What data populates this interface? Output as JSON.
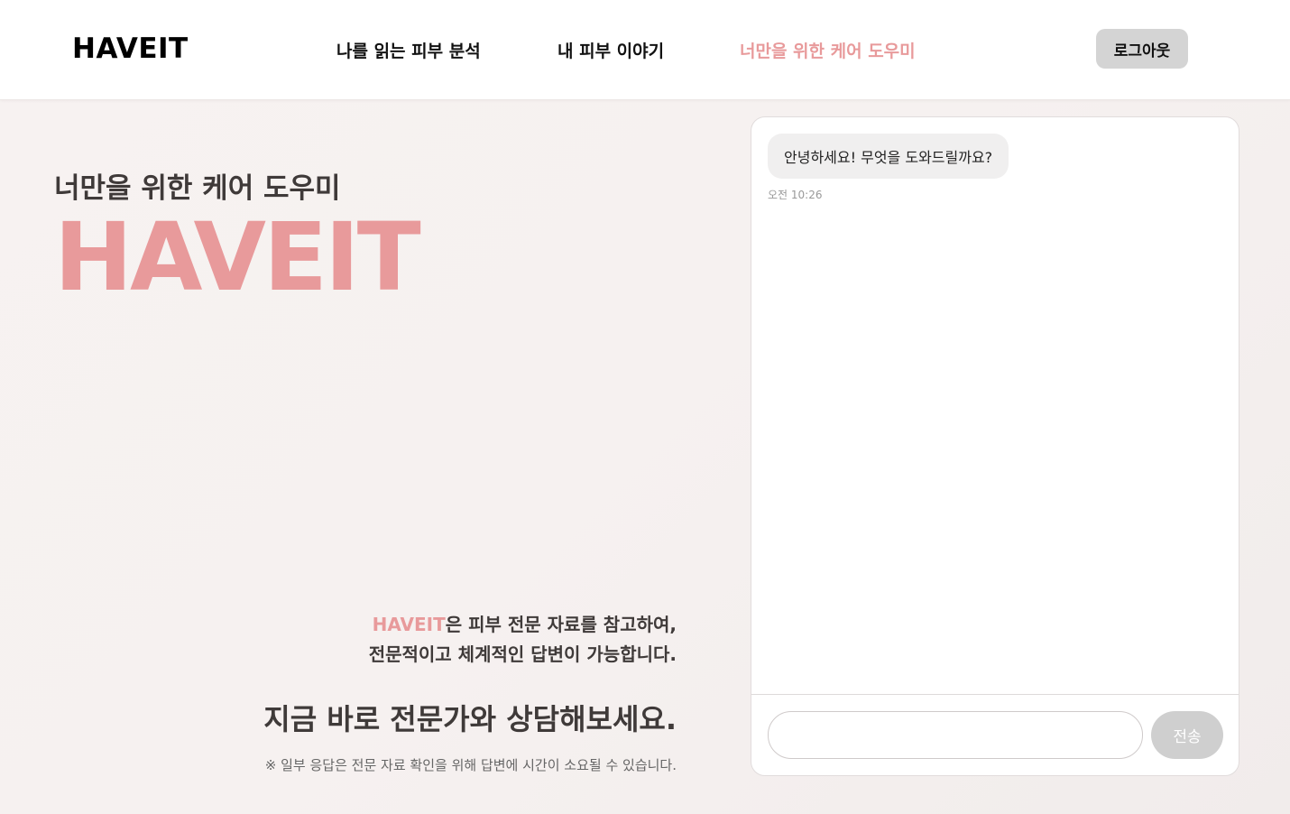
{
  "header": {
    "logo": "HAVEIT",
    "nav": [
      {
        "label": "나를 읽는 피부 분석"
      },
      {
        "label": "내 피부 이야기"
      },
      {
        "label": "너만을 위한 케어 도우미"
      }
    ],
    "logout_label": "로그아웃"
  },
  "hero": {
    "subtitle": "너만을 위한 케어 도우미",
    "title": "HAVEIT",
    "desc_brand": "HAVEIT",
    "desc_line1_rest": "은 피부 전문 자료를 참고하여,",
    "desc_line2": "전문적이고 체계적인 답변이 가능합니다.",
    "cta": "지금 바로 전문가와 상담해보세요.",
    "notice": "※ 일부 응답은 전문 자료 확인을 위해 답변에 시간이 소요될 수 있습니다."
  },
  "chat": {
    "messages": [
      {
        "text": "안녕하세요! 무엇을 도와드릴까요?",
        "time": "오전 10:26"
      }
    ],
    "input_value": "",
    "send_label": "전송"
  },
  "colors": {
    "accent": "#e89a9b",
    "text_dark": "#3f3a39",
    "background": "#f6f1f0"
  }
}
